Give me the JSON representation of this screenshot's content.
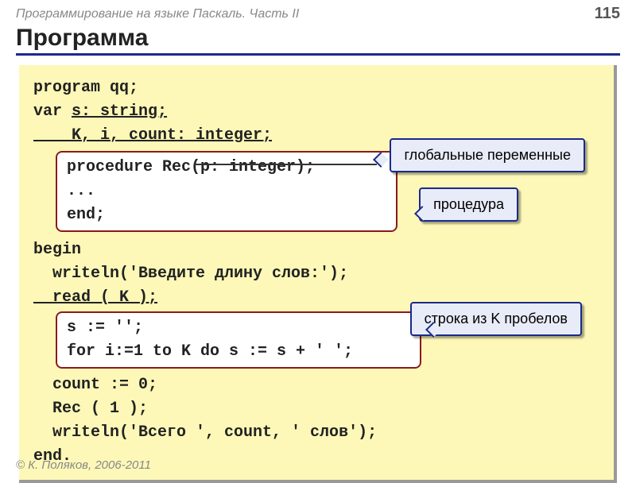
{
  "header": {
    "subject": "Программирование на языке Паскаль. Часть II",
    "page": "115"
  },
  "title": "Программа",
  "code": {
    "l1": "program qq;",
    "l2a": "var ",
    "l2b": "s: string;",
    "l3": "    K, i, count: integer;",
    "proc1": "procedure Rec(p: integer);",
    "proc2": "...",
    "proc3": "end;",
    "l4": "begin",
    "l5": "  writeln('Введите длину слов:');",
    "l6": "  read ( K );",
    "s1": "s := '';",
    "s2": "for i:=1 to K do s := s + ' ';",
    "l7": "  count := 0;",
    "l8": "  Rec ( 1 );",
    "l9": "  writeln('Всего ', count, ' слов');",
    "l10": "end."
  },
  "callouts": {
    "c1": "глобальные переменные",
    "c2": "процедура",
    "c3": "строка из K пробелов"
  },
  "footer": "© К. Поляков, 2006-2011"
}
